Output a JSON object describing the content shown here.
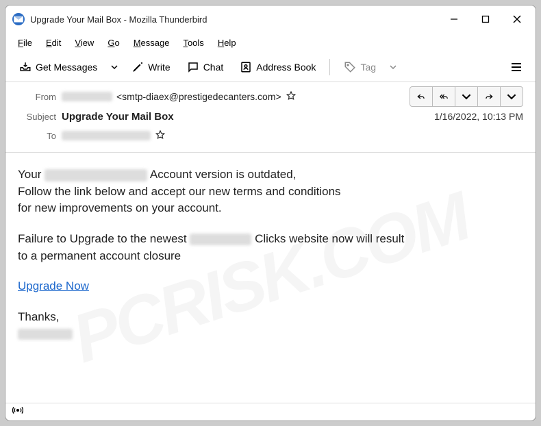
{
  "window": {
    "title": "Upgrade Your Mail Box - Mozilla Thunderbird"
  },
  "menubar": {
    "file": "File",
    "edit": "Edit",
    "view": "View",
    "go": "Go",
    "message": "Message",
    "tools": "Tools",
    "help": "Help"
  },
  "toolbar": {
    "get_messages": "Get Messages",
    "write": "Write",
    "chat": "Chat",
    "address_book": "Address Book",
    "tag": "Tag"
  },
  "header": {
    "from_label": "From",
    "from_email": "<smtp-diaex@prestigedecanters.com>",
    "subject_label": "Subject",
    "subject_value": "Upgrade Your Mail Box",
    "to_label": "To",
    "date": "1/16/2022, 10:13 PM"
  },
  "body": {
    "line1a": "Your ",
    "line1b": " Account version is outdated,",
    "line2": "Follow the link below and accept our new terms and conditions",
    "line3": "for new improvements on your account.",
    "line4a": "Failure to Upgrade to the newest ",
    "line4b": " Clicks website now will result",
    "line5": "to a permanent account closure",
    "link": "Upgrade Now",
    "thanks": "Thanks,"
  },
  "watermark": "PCRISK.COM"
}
